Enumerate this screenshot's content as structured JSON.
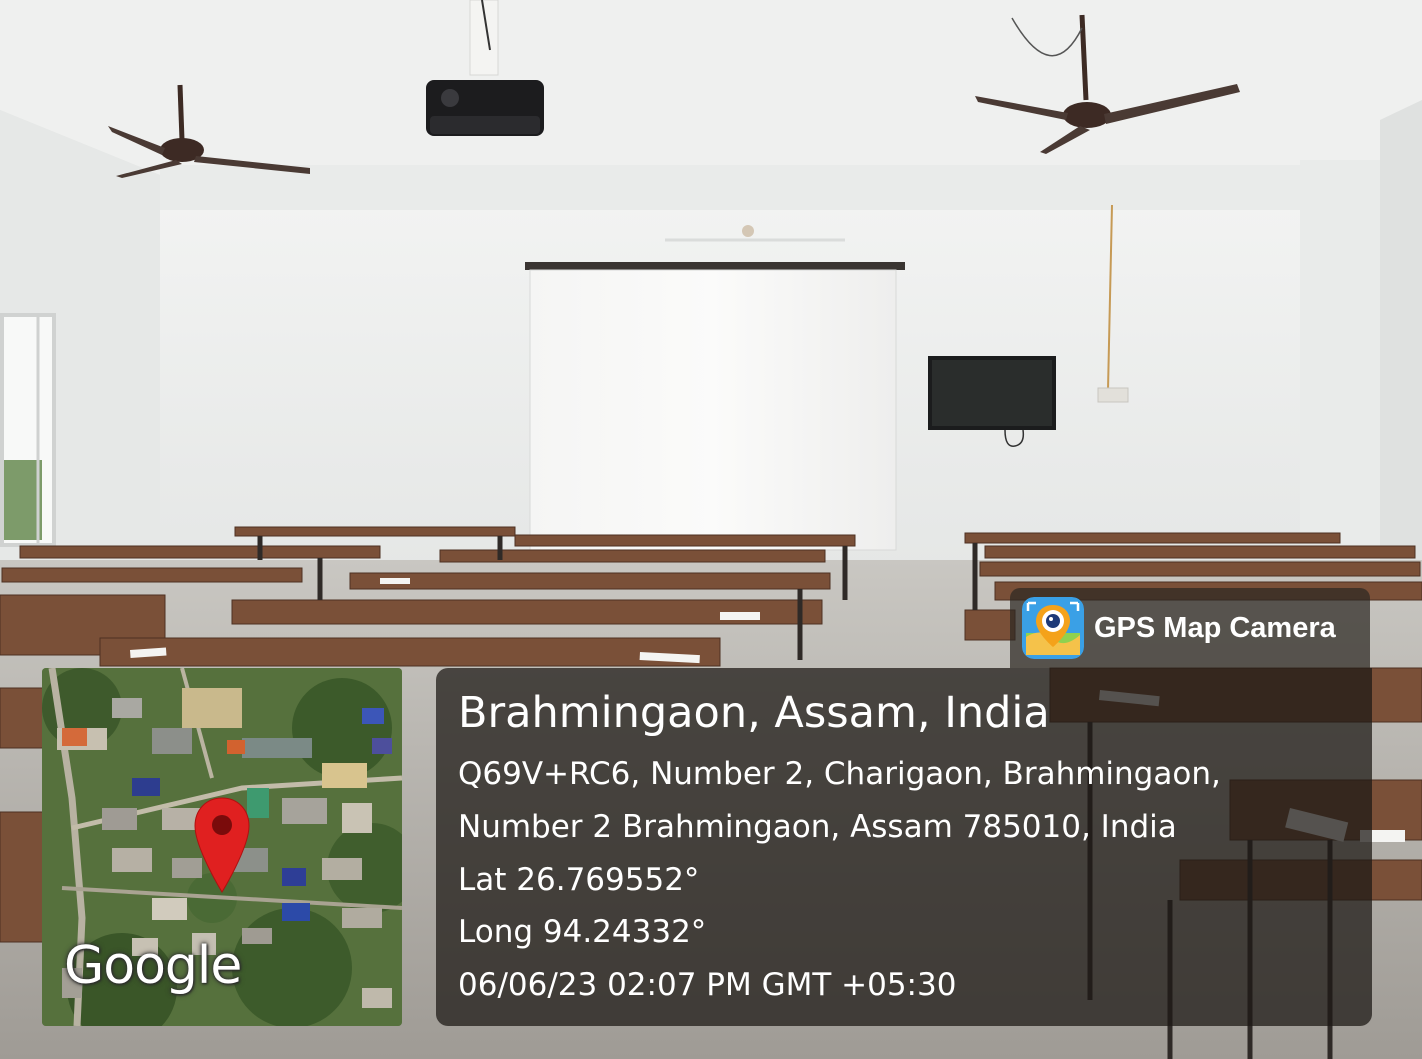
{
  "overlay": {
    "brand": {
      "label": "GPS Map Camera",
      "icon": "gps-map-camera-app-icon"
    },
    "location": {
      "place": "Brahmingaon, Assam, India",
      "address_line_1": "Q69V+RC6, Number 2, Charigaon, Brahmingaon,",
      "address_line_2": "Number 2 Brahmingaon, Assam 785010, India",
      "latitude": "Lat 26.769552°",
      "longitude": "Long 94.24332°",
      "timestamp": "06/06/23 02:07 PM GMT +05:30"
    },
    "map": {
      "wordmark": "Google",
      "pin_icon": "map-pin-icon",
      "pin_color": "#e02020"
    }
  },
  "colors": {
    "wall": "#eef0ef",
    "ceiling": "#f1f2f1",
    "bench_wood": "#7a5038",
    "overlay_dark": "#231f1b"
  }
}
